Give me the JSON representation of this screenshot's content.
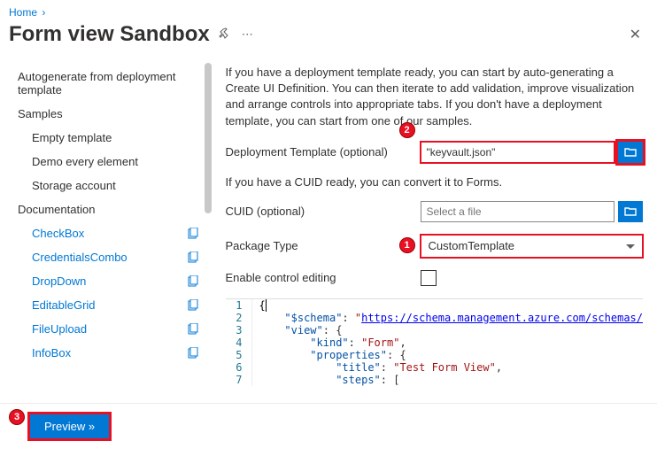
{
  "breadcrumb": {
    "home": "Home"
  },
  "title": "Form view Sandbox",
  "sidebar": {
    "autogen": "Autogenerate from deployment template",
    "samples_label": "Samples",
    "samples": [
      {
        "label": "Empty template"
      },
      {
        "label": "Demo every element"
      },
      {
        "label": "Storage account"
      }
    ],
    "docs_label": "Documentation",
    "docs": [
      {
        "label": "CheckBox"
      },
      {
        "label": "CredentialsCombo"
      },
      {
        "label": "DropDown"
      },
      {
        "label": "EditableGrid"
      },
      {
        "label": "FileUpload"
      },
      {
        "label": "InfoBox"
      }
    ]
  },
  "content": {
    "intro": "If you have a deployment template ready, you can start by auto-generating a Create UI Definition. You can then iterate to add validation, improve visualization and arrange controls into appropriate tabs. If you don't have a deployment template, you can start from one of our samples.",
    "dep_label": "Deployment Template (optional)",
    "dep_value": "\"keyvault.json\"",
    "cuid_help": "If you have a CUID ready, you can convert it to Forms.",
    "cuid_label": "CUID (optional)",
    "cuid_placeholder": "Select a file",
    "pkg_label": "Package Type",
    "pkg_value": "CustomTemplate",
    "enable_label": "Enable control editing"
  },
  "code": {
    "l1": "{",
    "l2a": "    \"$schema\"",
    "l2b": ": ",
    "l2c": "\"",
    "l2d": "https://schema.management.azure.com/schemas/",
    "l3a": "    \"view\"",
    "l3b": ": {",
    "l4a": "        \"kind\"",
    "l4b": ": ",
    "l4c": "\"Form\"",
    "l4d": ",",
    "l5a": "        \"properties\"",
    "l5b": ": {",
    "l6a": "            \"title\"",
    "l6b": ": ",
    "l6c": "\"Test Form View\"",
    "l6d": ",",
    "l7a": "            \"steps\"",
    "l7b": ": ["
  },
  "footer": {
    "preview": "Preview »"
  },
  "badges": {
    "b1": "1",
    "b2": "2",
    "b3": "3"
  }
}
